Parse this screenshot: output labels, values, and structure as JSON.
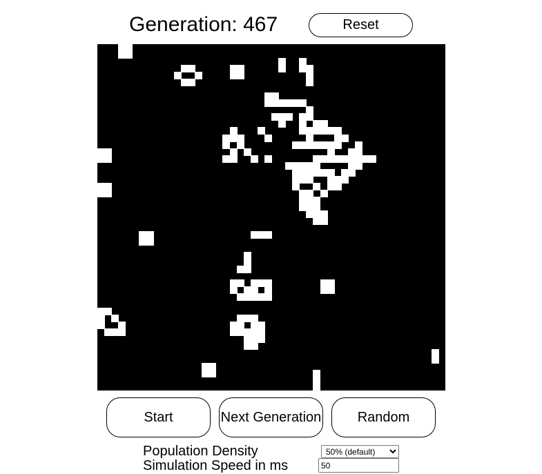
{
  "header": {
    "generation_label": "Generation: 467",
    "reset_label": "Reset"
  },
  "controls": {
    "start_label": "Start",
    "next_label": "Next Generation",
    "random_label": "Random"
  },
  "settings": {
    "density_label": "Population Density",
    "density_selected": "50% (default)",
    "speed_label": "Simulation Speed in ms",
    "speed_value": "50"
  },
  "grid": {
    "columns": 50,
    "rows": 50,
    "live_color": "#ffffff",
    "dead_color": "#000000",
    "live_cells": [
      [
        3,
        0
      ],
      [
        4,
        0
      ],
      [
        3,
        1
      ],
      [
        4,
        1
      ],
      [
        26,
        2
      ],
      [
        29,
        2
      ],
      [
        12,
        3
      ],
      [
        13,
        3
      ],
      [
        19,
        3
      ],
      [
        20,
        3
      ],
      [
        26,
        3
      ],
      [
        29,
        3
      ],
      [
        30,
        3
      ],
      [
        11,
        4
      ],
      [
        14,
        4
      ],
      [
        19,
        4
      ],
      [
        20,
        4
      ],
      [
        30,
        4
      ],
      [
        12,
        5
      ],
      [
        13,
        5
      ],
      [
        30,
        5
      ],
      [
        24,
        7
      ],
      [
        25,
        7
      ],
      [
        24,
        8
      ],
      [
        25,
        8
      ],
      [
        26,
        8
      ],
      [
        27,
        8
      ],
      [
        28,
        8
      ],
      [
        29,
        8
      ],
      [
        30,
        9
      ],
      [
        25,
        10
      ],
      [
        26,
        10
      ],
      [
        27,
        10
      ],
      [
        29,
        10
      ],
      [
        30,
        10
      ],
      [
        26,
        11
      ],
      [
        29,
        11
      ],
      [
        31,
        11
      ],
      [
        32,
        11
      ],
      [
        19,
        12
      ],
      [
        23,
        12
      ],
      [
        29,
        12
      ],
      [
        30,
        12
      ],
      [
        31,
        12
      ],
      [
        32,
        12
      ],
      [
        33,
        12
      ],
      [
        34,
        12
      ],
      [
        18,
        13
      ],
      [
        19,
        13
      ],
      [
        20,
        13
      ],
      [
        24,
        13
      ],
      [
        30,
        13
      ],
      [
        34,
        13
      ],
      [
        35,
        13
      ],
      [
        18,
        14
      ],
      [
        20,
        14
      ],
      [
        28,
        14
      ],
      [
        29,
        14
      ],
      [
        30,
        14
      ],
      [
        31,
        14
      ],
      [
        32,
        14
      ],
      [
        33,
        14
      ],
      [
        34,
        14
      ],
      [
        37,
        14
      ],
      [
        0,
        15
      ],
      [
        1,
        15
      ],
      [
        19,
        15
      ],
      [
        21,
        15
      ],
      [
        33,
        15
      ],
      [
        36,
        15
      ],
      [
        37,
        15
      ],
      [
        0,
        16
      ],
      [
        1,
        16
      ],
      [
        18,
        16
      ],
      [
        19,
        16
      ],
      [
        22,
        16
      ],
      [
        24,
        16
      ],
      [
        31,
        16
      ],
      [
        32,
        16
      ],
      [
        33,
        16
      ],
      [
        34,
        16
      ],
      [
        35,
        16
      ],
      [
        36,
        16
      ],
      [
        37,
        16
      ],
      [
        38,
        16
      ],
      [
        39,
        16
      ],
      [
        27,
        17
      ],
      [
        28,
        17
      ],
      [
        29,
        17
      ],
      [
        30,
        17
      ],
      [
        31,
        17
      ],
      [
        36,
        17
      ],
      [
        37,
        17
      ],
      [
        28,
        18
      ],
      [
        29,
        18
      ],
      [
        30,
        18
      ],
      [
        31,
        18
      ],
      [
        32,
        18
      ],
      [
        33,
        18
      ],
      [
        35,
        18
      ],
      [
        36,
        18
      ],
      [
        28,
        19
      ],
      [
        29,
        19
      ],
      [
        30,
        19
      ],
      [
        33,
        19
      ],
      [
        34,
        19
      ],
      [
        35,
        19
      ],
      [
        0,
        20
      ],
      [
        1,
        20
      ],
      [
        28,
        20
      ],
      [
        31,
        20
      ],
      [
        33,
        20
      ],
      [
        34,
        20
      ],
      [
        0,
        21
      ],
      [
        1,
        21
      ],
      [
        29,
        21
      ],
      [
        30,
        21
      ],
      [
        32,
        21
      ],
      [
        29,
        22
      ],
      [
        30,
        22
      ],
      [
        31,
        22
      ],
      [
        29,
        23
      ],
      [
        30,
        23
      ],
      [
        31,
        23
      ],
      [
        30,
        24
      ],
      [
        31,
        24
      ],
      [
        32,
        24
      ],
      [
        31,
        25
      ],
      [
        32,
        25
      ],
      [
        6,
        27
      ],
      [
        7,
        27
      ],
      [
        22,
        27
      ],
      [
        23,
        27
      ],
      [
        24,
        27
      ],
      [
        6,
        28
      ],
      [
        7,
        28
      ],
      [
        21,
        30
      ],
      [
        21,
        31
      ],
      [
        20,
        32
      ],
      [
        21,
        32
      ],
      [
        19,
        34
      ],
      [
        20,
        34
      ],
      [
        22,
        34
      ],
      [
        23,
        34
      ],
      [
        24,
        34
      ],
      [
        32,
        34
      ],
      [
        33,
        34
      ],
      [
        19,
        35
      ],
      [
        21,
        35
      ],
      [
        22,
        35
      ],
      [
        24,
        35
      ],
      [
        32,
        35
      ],
      [
        33,
        35
      ],
      [
        20,
        36
      ],
      [
        21,
        36
      ],
      [
        22,
        36
      ],
      [
        23,
        36
      ],
      [
        24,
        36
      ],
      [
        0,
        38
      ],
      [
        1,
        38
      ],
      [
        0,
        39
      ],
      [
        2,
        39
      ],
      [
        20,
        39
      ],
      [
        21,
        39
      ],
      [
        22,
        39
      ],
      [
        0,
        40
      ],
      [
        3,
        40
      ],
      [
        19,
        40
      ],
      [
        20,
        40
      ],
      [
        22,
        40
      ],
      [
        23,
        40
      ],
      [
        1,
        41
      ],
      [
        2,
        41
      ],
      [
        3,
        41
      ],
      [
        19,
        41
      ],
      [
        20,
        41
      ],
      [
        21,
        41
      ],
      [
        22,
        41
      ],
      [
        23,
        41
      ],
      [
        21,
        42
      ],
      [
        22,
        42
      ],
      [
        23,
        42
      ],
      [
        21,
        43
      ],
      [
        22,
        43
      ],
      [
        48,
        44
      ],
      [
        48,
        45
      ],
      [
        15,
        46
      ],
      [
        16,
        46
      ],
      [
        15,
        47
      ],
      [
        16,
        47
      ],
      [
        31,
        47
      ],
      [
        31,
        48
      ],
      [
        31,
        49
      ]
    ]
  }
}
